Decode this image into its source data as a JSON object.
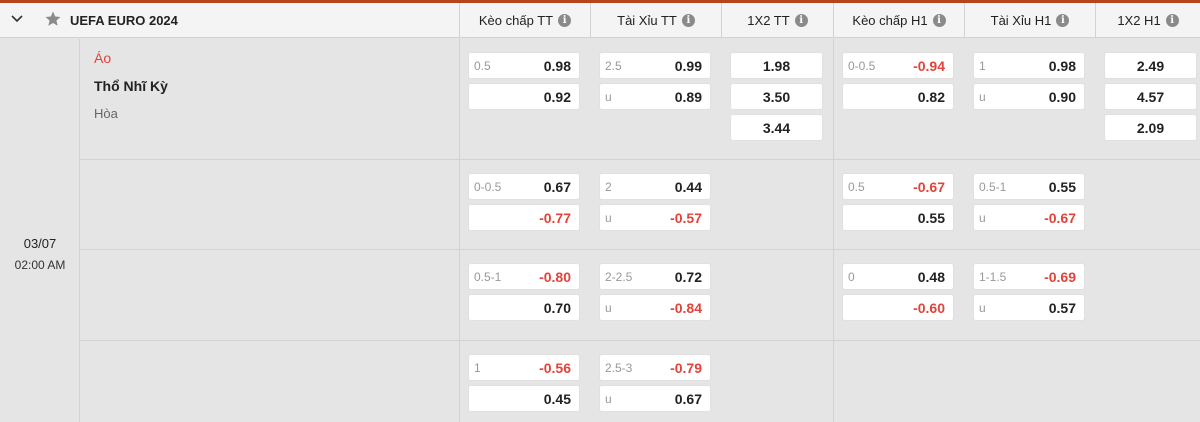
{
  "league": {
    "name": "UEFA EURO 2024"
  },
  "columns": [
    "Kèo chấp TT",
    "Tài Xỉu TT",
    "1X2 TT",
    "Kèo chấp H1",
    "Tài Xỉu H1",
    "1X2 H1"
  ],
  "match": {
    "home": "Áo",
    "away": "Thổ Nhĩ Kỳ",
    "draw": "Hòa",
    "date": "03/07",
    "time": "02:00 AM"
  },
  "rows": [
    {
      "hdp_tt": {
        "line": "0.5",
        "top": "0.98",
        "bot": "0.92"
      },
      "ou_tt": {
        "line": "2.5",
        "u": "u",
        "top": "0.99",
        "bot": "0.89"
      },
      "x12_tt": [
        "1.98",
        "3.50",
        "3.44"
      ],
      "hdp_h1": {
        "line": "0-0.5",
        "top": "-0.94",
        "bot": "0.82"
      },
      "ou_h1": {
        "line": "1",
        "u": "u",
        "top": "0.98",
        "bot": "0.90"
      },
      "x12_h1": [
        "2.49",
        "4.57",
        "2.09"
      ]
    },
    {
      "hdp_tt": {
        "line": "0-0.5",
        "top": "0.67",
        "bot": "-0.77"
      },
      "ou_tt": {
        "line": "2",
        "u": "u",
        "top": "0.44",
        "bot": "-0.57"
      },
      "hdp_h1": {
        "line": "0.5",
        "top": "-0.67",
        "bot": "0.55"
      },
      "ou_h1": {
        "line": "0.5-1",
        "u": "u",
        "top": "0.55",
        "bot": "-0.67"
      }
    },
    {
      "hdp_tt": {
        "line": "0.5-1",
        "top": "-0.80",
        "bot": "0.70"
      },
      "ou_tt": {
        "line": "2-2.5",
        "u": "u",
        "top": "0.72",
        "bot": "-0.84"
      },
      "hdp_h1": {
        "line": "0",
        "top": "0.48",
        "bot": "-0.60"
      },
      "ou_h1": {
        "line": "1-1.5",
        "u": "u",
        "top": "-0.69",
        "bot": "0.57"
      }
    },
    {
      "hdp_tt": {
        "line": "1",
        "top": "-0.56",
        "bot": "0.45"
      },
      "ou_tt": {
        "line": "2.5-3",
        "u": "u",
        "top": "-0.79",
        "bot": "0.67"
      }
    }
  ],
  "colors": {
    "accent": "#b5441c",
    "negative": "#e0443a",
    "background": "#e5e5e5"
  },
  "icons": {
    "collapse": "chevron-down-icon",
    "favorite": "star-icon",
    "info": "info-icon"
  }
}
